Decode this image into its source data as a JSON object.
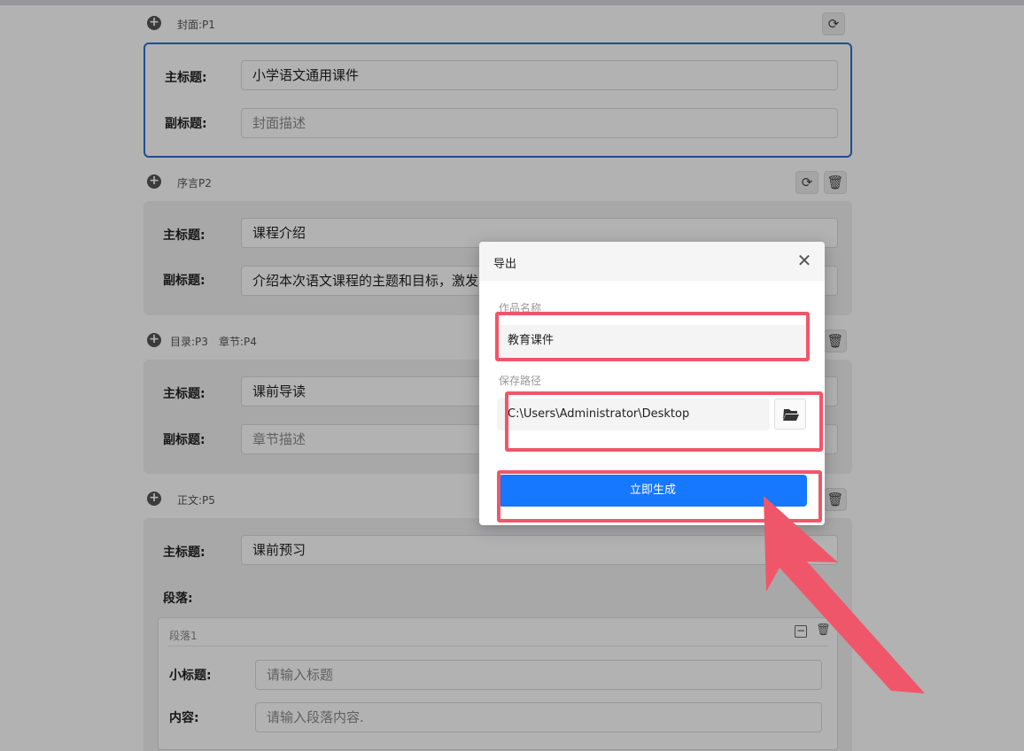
{
  "sections": {
    "s1": {
      "label": "封面:P1",
      "title_label": "主标题:",
      "title_value": "小学语文通用课件",
      "sub_label": "副标题:",
      "sub_placeholder": "封面描述"
    },
    "s2": {
      "label": "序言P2",
      "title_label": "主标题:",
      "title_value": "课程介绍",
      "sub_label": "副标题:",
      "sub_value": "介绍本次语文课程的主题和目标，激发"
    },
    "s3": {
      "label_a": "目录:P3",
      "label_b": "章节:P4",
      "title_label": "主标题:",
      "title_value": "课前导读",
      "sub_label": "副标题:",
      "sub_placeholder": "章节描述"
    },
    "s4": {
      "label": "正文:P5",
      "title_label": "主标题:",
      "title_value": "课前预习",
      "para_label": "段落:",
      "para1": {
        "name": "段落1",
        "subtitle_label": "小标题:",
        "subtitle_placeholder": "请输入标题",
        "content_label": "内容:",
        "content_placeholder": "请输入段落内容."
      }
    }
  },
  "dialog": {
    "title": "导出",
    "name_label": "作品名称",
    "name_value": "教育课件",
    "path_label": "保存路径",
    "path_value": "C:\\Users\\Administrator\\Desktop",
    "generate_label": "立即生成"
  },
  "icons": {
    "add": "plus-circle-icon",
    "refresh": "refresh-icon",
    "delete": "trash-icon",
    "collapse": "minus-square-icon",
    "folder": "folder-open-icon",
    "close": "close-icon",
    "annotation": "arrow-annotation"
  },
  "colors": {
    "accent": "#1677ff",
    "highlight": "#f0566a",
    "selected_border": "#2d6fd0"
  }
}
